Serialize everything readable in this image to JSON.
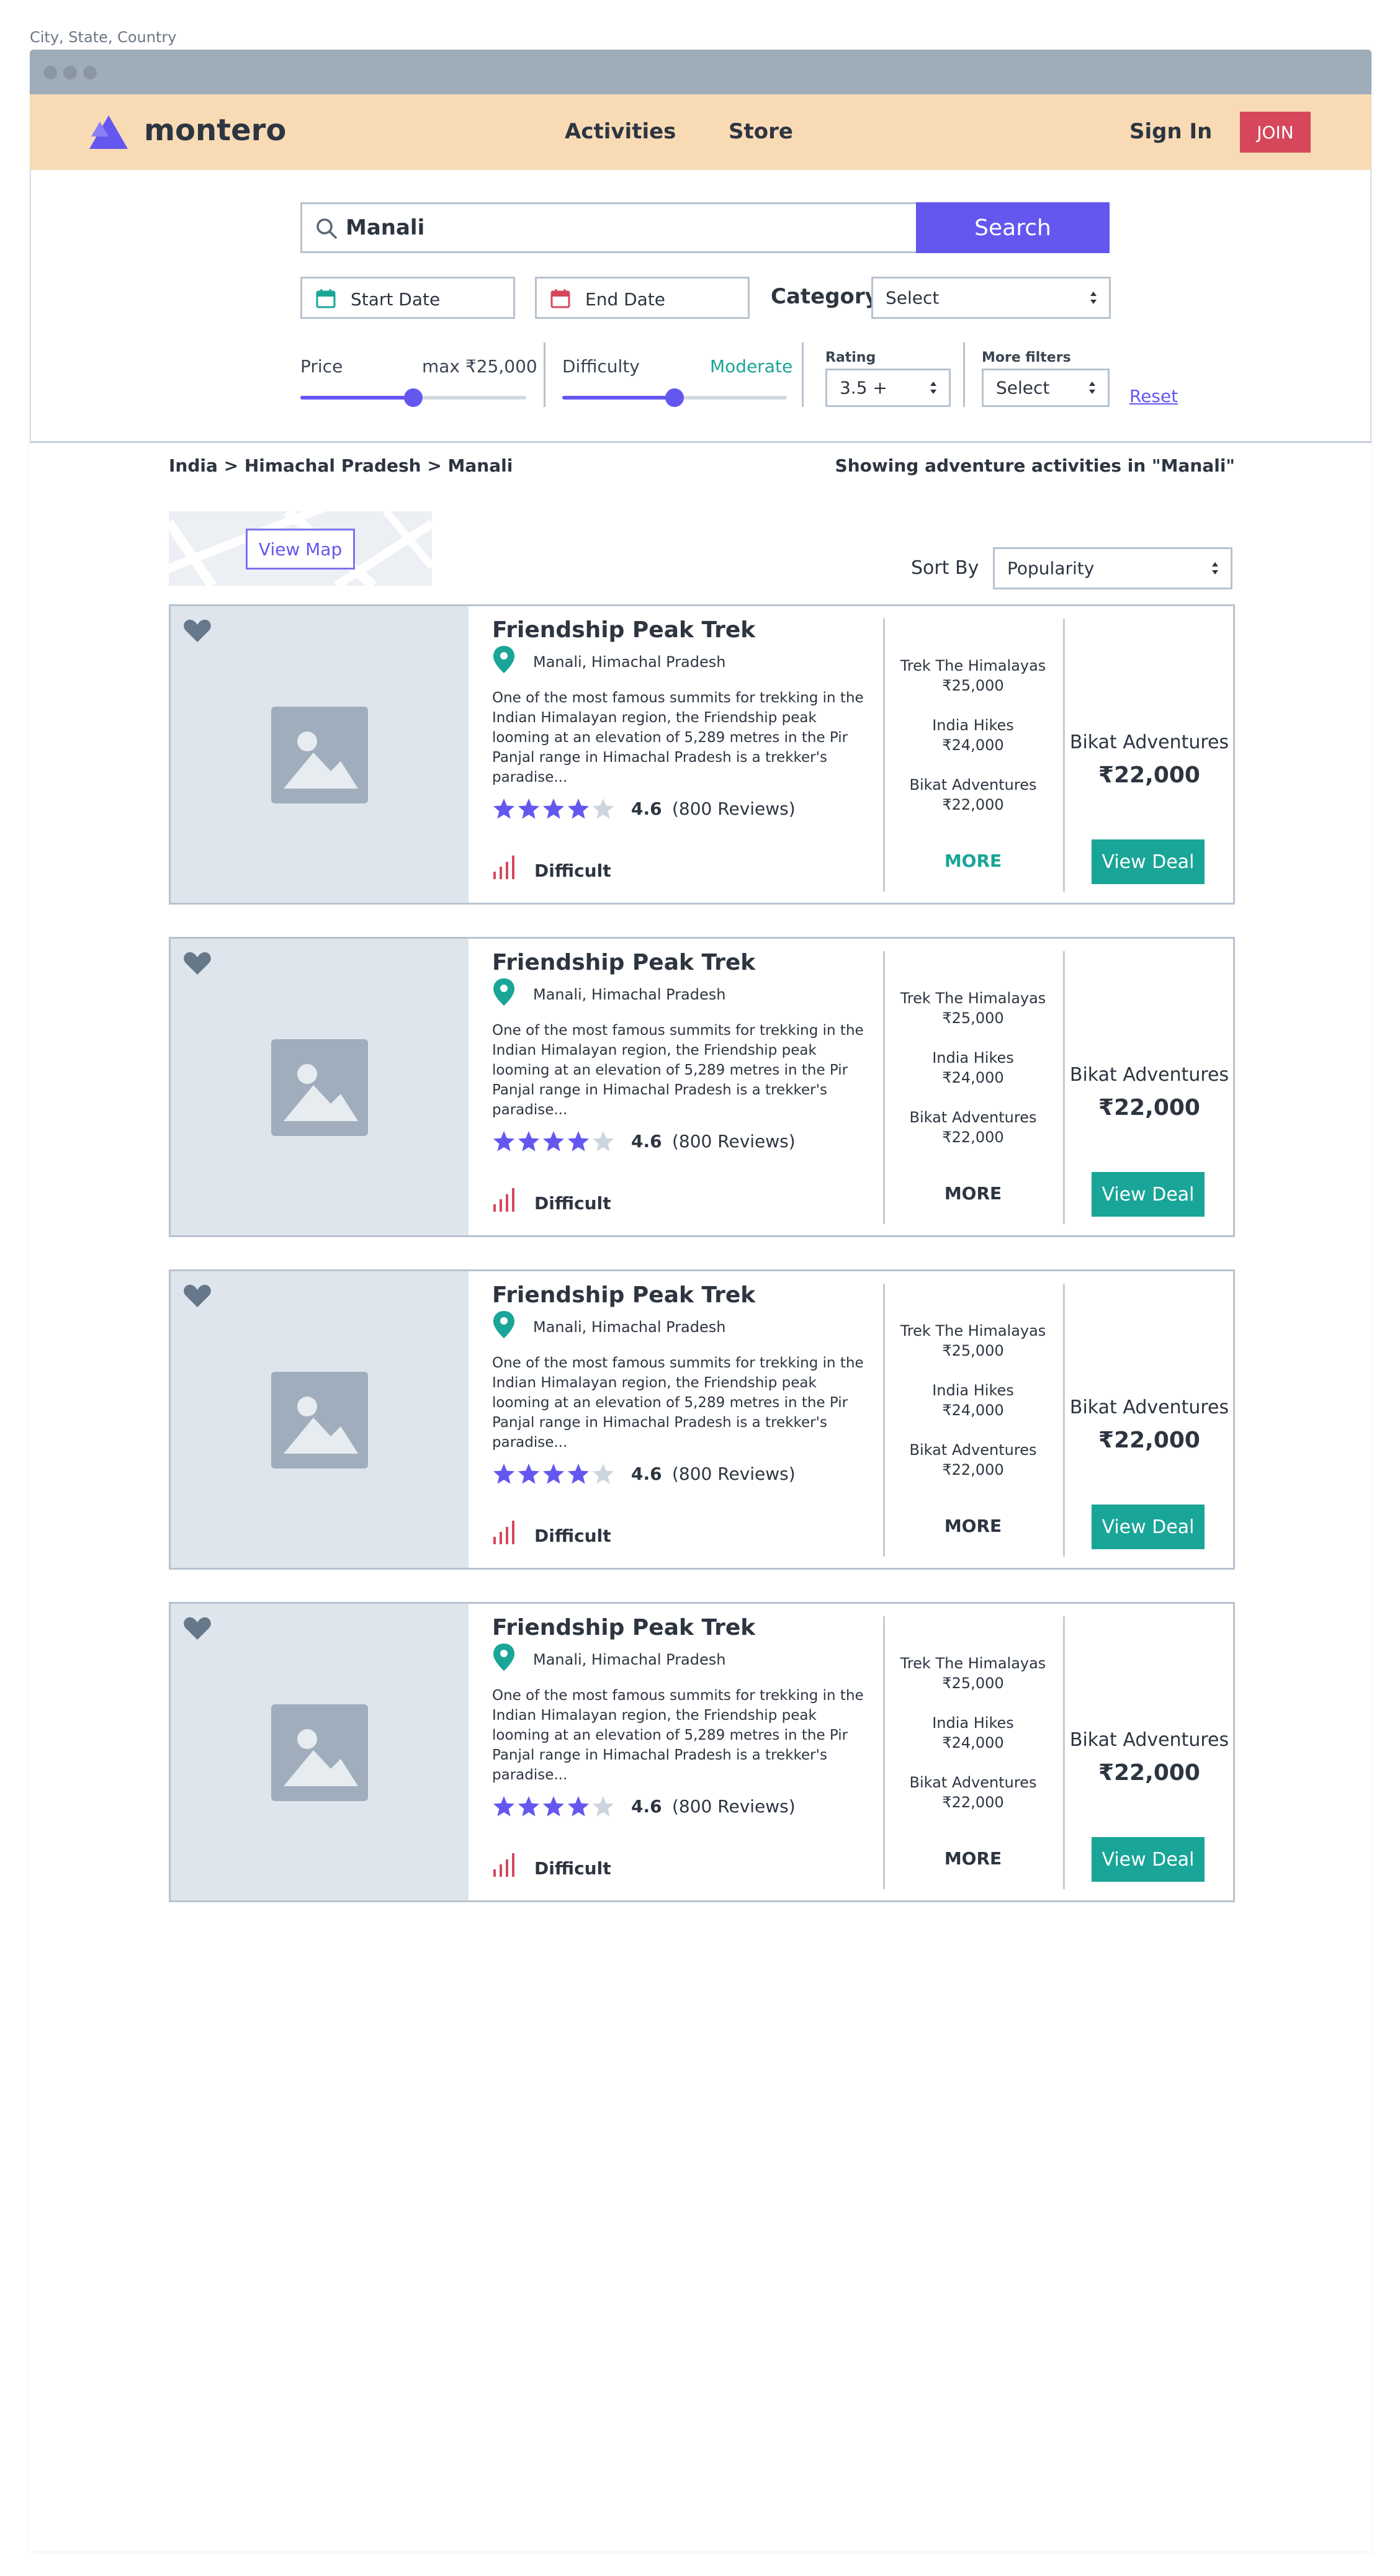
{
  "caption": "City, State, Country",
  "nav": {
    "brand": "montero",
    "links": [
      "Activities",
      "Store"
    ],
    "sign_in": "Sign In",
    "join": "JOIN"
  },
  "search": {
    "value": "Manali",
    "button": "Search",
    "start_date": "Start Date",
    "end_date": "End Date",
    "category_label": "Category",
    "category_value": "Select"
  },
  "filters": {
    "price_label": "Price",
    "price_value": "max ₹25,000",
    "price_level": 0.5,
    "difficulty_label": "Difficulty",
    "difficulty_value": "Moderate",
    "difficulty_level": 0.5,
    "rating_label": "Rating",
    "rating_value": "3.5 +",
    "more_label": "More filters",
    "more_value": "Select",
    "reset": "Reset"
  },
  "breadcrumb": "India > Himachal Pradesh > Manali",
  "showing": "Showing adventure activities in \"Manali\"",
  "map": {
    "button": "View Map"
  },
  "sort": {
    "label": "Sort By",
    "value": "Popularity"
  },
  "colors": {
    "accent": "#6457f0",
    "teal": "#19a597",
    "join": "#d6475c",
    "nav_bg": "#f8dbb5"
  },
  "listings": [
    {
      "title": "Friendship Peak Trek",
      "location": "Manali, Himachal Pradesh",
      "description": "One of the most famous summits for trekking in the Indian Himalayan region, the Friendship peak looming at an elevation of 5,289 metres in the Pir Panjal range in Himachal Pradesh is a trekker's paradise...",
      "stars": 4,
      "rating": "4.6",
      "reviews": "(800 Reviews)",
      "difficulty": "Difficult",
      "operators": [
        {
          "name": "Trek The Himalayas",
          "price": "₹25,000"
        },
        {
          "name": "India Hikes",
          "price": "₹24,000"
        },
        {
          "name": "Bikat Adventures",
          "price": "₹22,000"
        }
      ],
      "more": "MORE",
      "more_color": "#19a597",
      "best_operator": "Bikat Adventures",
      "best_price": "₹22,000",
      "deal": "View Deal"
    },
    {
      "title": "Friendship Peak Trek",
      "location": "Manali, Himachal Pradesh",
      "description": "One of the most famous summits for trekking in the Indian Himalayan region, the Friendship peak looming at an elevation of 5,289 metres in the Pir Panjal range in Himachal Pradesh is a trekker's paradise...",
      "stars": 4,
      "rating": "4.6",
      "reviews": "(800 Reviews)",
      "difficulty": "Difficult",
      "operators": [
        {
          "name": "Trek The Himalayas",
          "price": "₹25,000"
        },
        {
          "name": "India Hikes",
          "price": "₹24,000"
        },
        {
          "name": "Bikat Adventures",
          "price": "₹22,000"
        }
      ],
      "more": "MORE",
      "more_color": "#2d3541",
      "best_operator": "Bikat Adventures",
      "best_price": "₹22,000",
      "deal": "View Deal"
    },
    {
      "title": "Friendship Peak Trek",
      "location": "Manali, Himachal Pradesh",
      "description": "One of the most famous summits for trekking in the Indian Himalayan region, the Friendship peak looming at an elevation of 5,289 metres in the Pir Panjal range in Himachal Pradesh is a trekker's paradise...",
      "stars": 4,
      "rating": "4.6",
      "reviews": "(800 Reviews)",
      "difficulty": "Difficult",
      "operators": [
        {
          "name": "Trek The Himalayas",
          "price": "₹25,000"
        },
        {
          "name": "India Hikes",
          "price": "₹24,000"
        },
        {
          "name": "Bikat Adventures",
          "price": "₹22,000"
        }
      ],
      "more": "MORE",
      "more_color": "#2d3541",
      "best_operator": "Bikat Adventures",
      "best_price": "₹22,000",
      "deal": "View Deal"
    },
    {
      "title": "Friendship Peak Trek",
      "location": "Manali, Himachal Pradesh",
      "description": "One of the most famous summits for trekking in the Indian Himalayan region, the Friendship peak looming at an elevation of 5,289 metres in the Pir Panjal range in Himachal Pradesh is a trekker's paradise...",
      "stars": 4,
      "rating": "4.6",
      "reviews": "(800 Reviews)",
      "difficulty": "Difficult",
      "operators": [
        {
          "name": "Trek The Himalayas",
          "price": "₹25,000"
        },
        {
          "name": "India Hikes",
          "price": "₹24,000"
        },
        {
          "name": "Bikat Adventures",
          "price": "₹22,000"
        }
      ],
      "more": "MORE",
      "more_color": "#2d3541",
      "best_operator": "Bikat Adventures",
      "best_price": "₹22,000",
      "deal": "View Deal"
    }
  ]
}
